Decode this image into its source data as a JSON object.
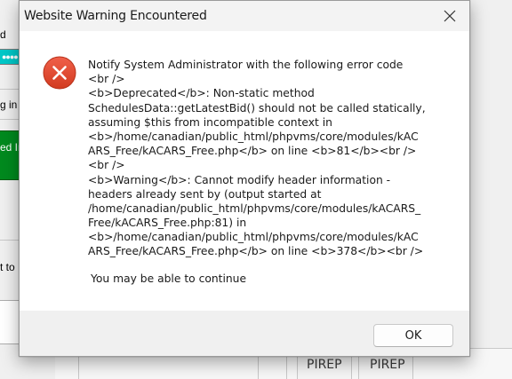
{
  "background_app": {
    "fragments": {
      "top_left_text": "d",
      "mid_left_text": "g in",
      "green_button_text": "ed Ir",
      "lower_left_text": "t to"
    },
    "cyan_field_value": "●●●●",
    "grid": {
      "column_headers": [
        "PIREP",
        "PIREP"
      ]
    },
    "colors": {
      "cyan": "#00c8c8",
      "green": "#008a1e"
    }
  },
  "dialog": {
    "title": "Website Warning Encountered",
    "close_icon": "close-icon",
    "error_icon": "error-icon",
    "error_icon_color": "#e5452b",
    "message_lines": [
      "Notify System Administrator with the following error code",
      "<br />",
      "<b>Deprecated</b>:  Non-static method",
      "SchedulesData::getLatestBid() should not be called statically,",
      "assuming $this from incompatible context in",
      "<b>/home/canadian/public_html/phpvms/core/modules/kAC",
      "ARS_Free/kACARS_Free.php</b> on line <b>81</b><br />",
      "<br />",
      "<b>Warning</b>:  Cannot modify header information -",
      "headers already sent by (output started at",
      "/home/canadian/public_html/phpvms/core/modules/kACARS_",
      "Free/kACARS_Free.php:81) in",
      "<b>/home/canadian/public_html/phpvms/core/modules/kAC",
      "ARS_Free/kACARS_Free.php</b> on line <b>378</b><br />"
    ],
    "continue_text": "You may be able to continue",
    "ok_label": "OK"
  }
}
